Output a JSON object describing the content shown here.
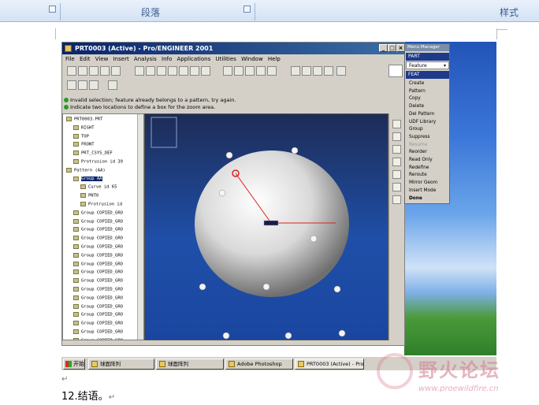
{
  "ribbon": {
    "group_paragraph": "段落",
    "group_styles": "样式"
  },
  "proe": {
    "title": "PRT0003 (Active) - Pro/ENGINEER 2001",
    "menu": [
      "File",
      "Edit",
      "View",
      "Insert",
      "Analysis",
      "Info",
      "Applications",
      "Utilities",
      "Window",
      "Help"
    ],
    "messages": [
      "Invalid selection; feature already belongs to a pattern, try again.",
      "Indicate two locations to define a box for the zoom area."
    ],
    "tree": [
      {
        "label": "PRT0003.PRT",
        "indent": 0
      },
      {
        "label": "RIGHT",
        "indent": 1
      },
      {
        "label": "TOP",
        "indent": 1
      },
      {
        "label": "FRONT",
        "indent": 1
      },
      {
        "label": "PRT_CSYS_DEF",
        "indent": 1
      },
      {
        "label": "Protrusion id 39",
        "indent": 1
      },
      {
        "label": "Pattern (AA)",
        "indent": 0
      },
      {
        "label": "Group AA",
        "indent": 1,
        "selected": true
      },
      {
        "label": "Curve id 65",
        "indent": 2
      },
      {
        "label": "PNT0",
        "indent": 2
      },
      {
        "label": "Protrusion id",
        "indent": 2
      },
      {
        "label": "Group COPIED_GRO",
        "indent": 1
      },
      {
        "label": "Group COPIED_GRO",
        "indent": 1
      },
      {
        "label": "Group COPIED_GRO",
        "indent": 1
      },
      {
        "label": "Group COPIED_GRO",
        "indent": 1
      },
      {
        "label": "Group COPIED_GRO",
        "indent": 1
      },
      {
        "label": "Group COPIED_GRO",
        "indent": 1
      },
      {
        "label": "Group COPIED_GRO",
        "indent": 1
      },
      {
        "label": "Group COPIED_GRO",
        "indent": 1
      },
      {
        "label": "Group COPIED_GRO",
        "indent": 1
      },
      {
        "label": "Group COPIED_GRO",
        "indent": 1
      },
      {
        "label": "Group COPIED_GRO",
        "indent": 1
      },
      {
        "label": "Group COPIED_GRO",
        "indent": 1
      },
      {
        "label": "Group COPIED_GRO",
        "indent": 1
      },
      {
        "label": "Group COPIED_GRO",
        "indent": 1
      },
      {
        "label": "Group COPIED_GRO",
        "indent": 1
      },
      {
        "label": "Group COPIED_GRO",
        "indent": 1
      }
    ]
  },
  "menu_manager": {
    "title": "Menu Manager",
    "part": "PART",
    "feature": "Feature",
    "feat": "FEAT",
    "items": [
      {
        "label": "Create",
        "state": "normal"
      },
      {
        "label": "Pattern",
        "state": "normal"
      },
      {
        "label": "Copy",
        "state": "normal"
      },
      {
        "label": "Delete",
        "state": "normal"
      },
      {
        "label": "Del Pattern",
        "state": "normal"
      },
      {
        "label": "UDF Library",
        "state": "normal"
      },
      {
        "label": "Group",
        "state": "normal"
      },
      {
        "label": "Suppress",
        "state": "normal"
      },
      {
        "label": "Resume",
        "state": "disabled"
      },
      {
        "label": "Reorder",
        "state": "normal"
      },
      {
        "label": "Read Only",
        "state": "normal"
      },
      {
        "label": "Redefine",
        "state": "normal"
      },
      {
        "label": "Reroute",
        "state": "normal"
      },
      {
        "label": "Mirror Geom",
        "state": "normal"
      },
      {
        "label": "Insert Mode",
        "state": "normal"
      },
      {
        "label": "Done",
        "state": "bold"
      }
    ]
  },
  "taskbar": {
    "start": "开始",
    "tasks": [
      "球面阵列",
      "球面阵列",
      "Adobe Photoshop",
      "PRT0003 (Active) - Pro/E..."
    ]
  },
  "watermark": {
    "name": "野火论坛",
    "url": "www.proewildfire.cn"
  },
  "document": {
    "conclusion": "12.结语。"
  }
}
